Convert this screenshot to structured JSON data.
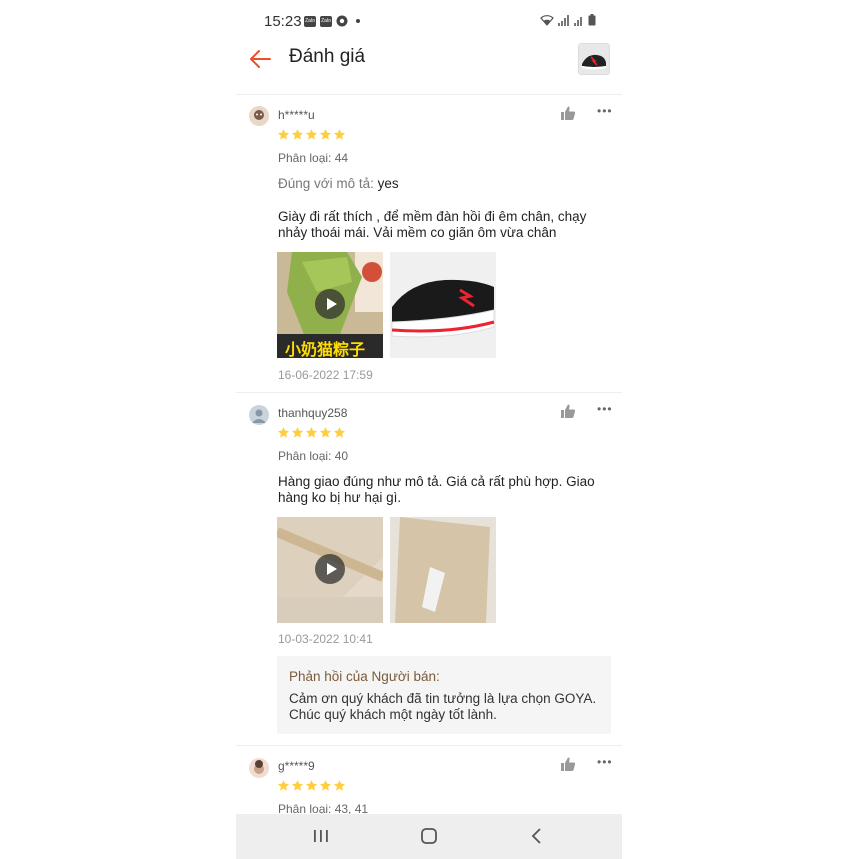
{
  "status_bar": {
    "time": "15:23",
    "apps": [
      "Zalo",
      "Zalo"
    ]
  },
  "header": {
    "title": "Đánh giá"
  },
  "reviews": [
    {
      "username": "h*****u",
      "rating": 5,
      "variant": "Phân loại: 44",
      "desc_label": "Đúng với mô tả:",
      "desc_value": "yes",
      "text": "Giày đi rất thích , để mềm đàn hồi đi êm chân, chạy nhảy thoái mái. Vải mềm co giãn ôm vừa chân",
      "media_caption": "小奶猫粽子",
      "date": "16-06-2022 17:59"
    },
    {
      "username": "thanhquy258",
      "rating": 5,
      "variant": "Phân loại: 40",
      "text": "Hàng giao đúng như mô tả. Giá cả rất phù hợp. Giao hàng ko bị hư hại gì.",
      "date": "10-03-2022 10:41",
      "seller_reply": {
        "title": "Phản hồi của Người bán:",
        "text": "Cảm ơn quý khách đã tin tưởng là lựa chọn GOYA. Chúc quý khách một ngày tốt lành."
      }
    },
    {
      "username": "g*****9",
      "rating": 5,
      "variant": "Phân loại: 43, 41"
    }
  ],
  "colors": {
    "accent": "#ee4d2d",
    "star": "#ffce3d"
  }
}
